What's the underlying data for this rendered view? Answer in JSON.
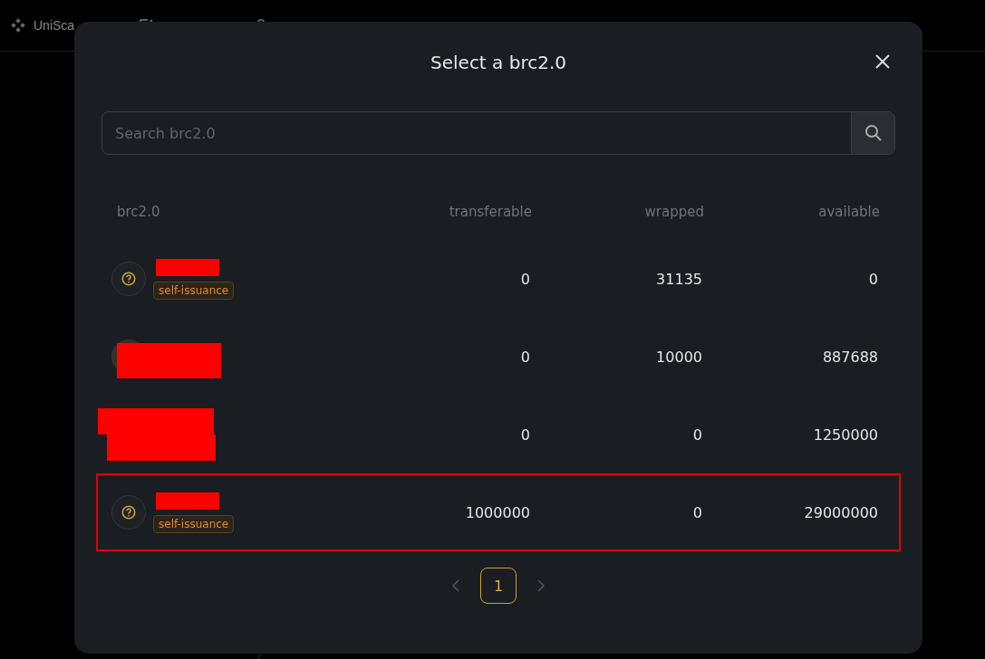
{
  "background_nav": {
    "brand": "UniSca"
  },
  "modal": {
    "title": "Select a brc2.0",
    "search": {
      "placeholder": "Search brc2.0"
    },
    "columns": [
      "brc2.0",
      "transferable",
      "wrapped",
      "available"
    ],
    "rows": [
      {
        "kind": "unknown",
        "badge": "self-issuance",
        "transferable": "0",
        "wrapped": "31135",
        "available": "0",
        "highlighted": false
      },
      {
        "kind": "image",
        "transferable": "0",
        "wrapped": "10000",
        "available": "887688",
        "highlighted": false
      },
      {
        "kind": "plain",
        "transferable": "0",
        "wrapped": "0",
        "available": "1250000",
        "highlighted": false
      },
      {
        "kind": "unknown",
        "badge": "self-issuance",
        "transferable": "1000000",
        "wrapped": "0",
        "available": "29000000",
        "highlighted": true
      }
    ],
    "pagination": {
      "pages": [
        {
          "label": "1",
          "selected": true
        }
      ]
    }
  }
}
